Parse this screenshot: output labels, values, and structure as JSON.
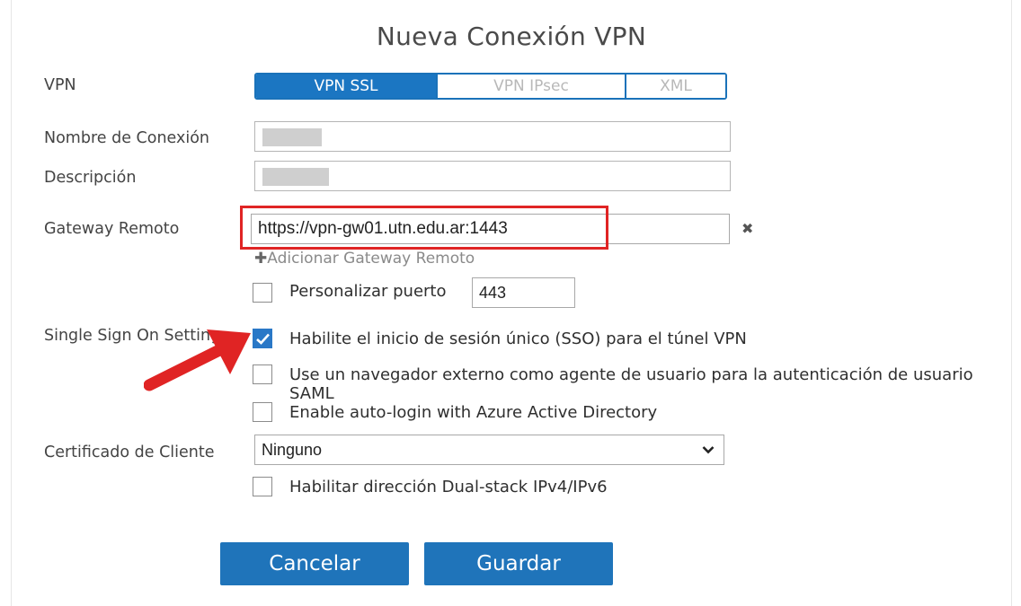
{
  "dialog": {
    "title": "Nueva Conexión VPN"
  },
  "labels": {
    "vpn": "VPN",
    "connection_name": "Nombre de Conexión",
    "description": "Descripción",
    "remote_gateway": "Gateway Remoto",
    "sso_settings": "Single Sign On Settings",
    "client_cert": "Certificado de Cliente"
  },
  "vpn_tabs": [
    {
      "label": "VPN SSL",
      "active": true
    },
    {
      "label": "VPN IPsec",
      "active": false
    },
    {
      "label": "XML",
      "active": false
    }
  ],
  "fields": {
    "remote_gateway_value": "https://vpn-gw01.utn.edu.ar:1443",
    "add_gateway_link": "Adicionar Gateway Remoto",
    "port_value": "443",
    "client_cert_selected": "Ninguno"
  },
  "checkboxes": {
    "custom_port": {
      "label": "Personalizar puerto",
      "checked": false
    },
    "sso": {
      "label": "Habilite el inicio de sesión único (SSO) para el túnel VPN",
      "checked": true
    },
    "external_browser": {
      "label": "Use un navegador externo como agente de usuario para la autenticación de usuario SAML",
      "checked": false
    },
    "azure_autologin": {
      "label": "Enable auto-login with Azure Active Directory",
      "checked": false
    },
    "dual_stack": {
      "label": "Habilitar dirección Dual-stack IPv4/IPv6",
      "checked": false
    }
  },
  "buttons": {
    "cancel": "Cancelar",
    "save": "Guardar"
  },
  "colors": {
    "accent": "#1b76c2",
    "highlight": "#e02424"
  }
}
